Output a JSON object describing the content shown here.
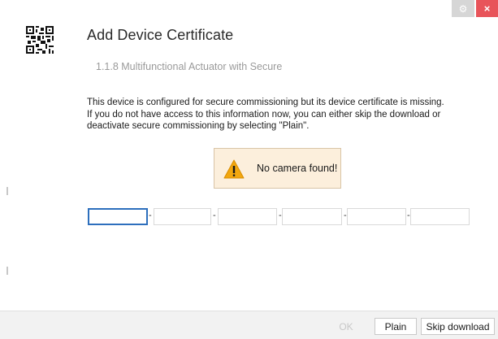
{
  "window": {
    "settings_icon": "gear-icon",
    "close_icon": "close-icon",
    "close_glyph": "×",
    "close_color": "#e8545a"
  },
  "header": {
    "icon": "qr-code-icon",
    "title": "Add Device Certificate",
    "subtitle": "1.1.8 Multifunctional Actuator with Secure"
  },
  "message": {
    "line1": "This device is configured for secure commissioning but its device certificate is missing.",
    "line2": "If you do not have access to this information now, you can either skip the download or",
    "line3": "deactivate secure commissioning by selecting \"Plain\"."
  },
  "warning": {
    "icon": "warning-icon",
    "text": "No camera found!",
    "background": "#fcefdc"
  },
  "certificate_fields": [
    {
      "value": "",
      "focused": true
    },
    {
      "value": ""
    },
    {
      "value": ""
    },
    {
      "value": ""
    },
    {
      "value": ""
    },
    {
      "value": ""
    }
  ],
  "separator": "-",
  "footer": {
    "ok_label": "OK",
    "plain_label": "Plain",
    "skip_label": "Skip download"
  }
}
